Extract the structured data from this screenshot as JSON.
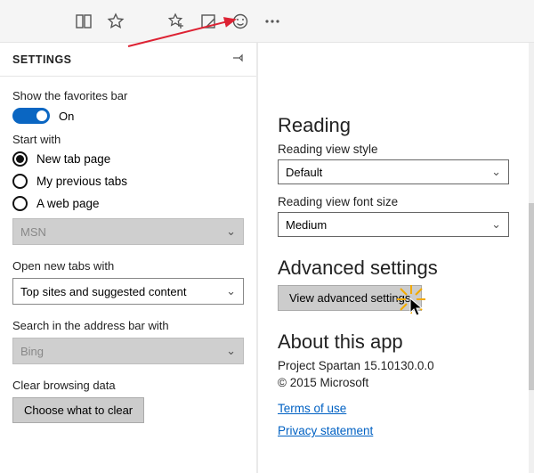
{
  "toolbar": {
    "icons": [
      "book-icon",
      "star-icon",
      "favorite-add-icon",
      "note-icon",
      "smiley-icon",
      "more-icon"
    ]
  },
  "settings": {
    "title": "SETTINGS",
    "favorites_label": "Show the favorites bar",
    "toggle_state": "On",
    "start_with_label": "Start with",
    "start_options": {
      "new_tab": "New tab page",
      "previous": "My previous tabs",
      "web_page": "A web page"
    },
    "homepage_value": "MSN",
    "open_tabs_label": "Open new tabs with",
    "open_tabs_value": "Top sites and suggested content",
    "search_label": "Search in the address bar with",
    "search_value": "Bing",
    "clear_label": "Clear browsing data",
    "clear_button": "Choose what to clear"
  },
  "right": {
    "reading_h": "Reading",
    "reading_style_label": "Reading view style",
    "reading_style_value": "Default",
    "reading_font_label": "Reading view font size",
    "reading_font_value": "Medium",
    "advanced_h": "Advanced settings",
    "advanced_button": "View advanced settings",
    "about_h": "About this app",
    "version": "Project Spartan 15.10130.0.0",
    "copyright": "© 2015 Microsoft",
    "terms": "Terms of use",
    "privacy": "Privacy statement"
  }
}
